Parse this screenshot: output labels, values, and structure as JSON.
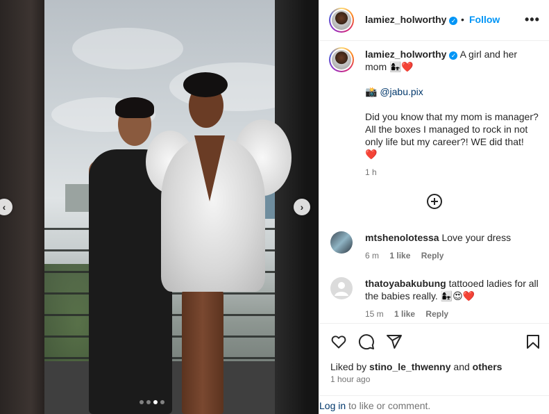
{
  "post": {
    "username": "lamiez_holworthy",
    "follow_label": "Follow",
    "more_label": "•••",
    "separator": "•"
  },
  "caption": {
    "username": "lamiez_holworthy",
    "line1": "A girl and her mom 👩‍👧❤️",
    "credit_icon": "📸",
    "credit_handle": "@jabu.pix",
    "body": "Did you know that my mom is manager? All the boxes I managed to rock in not only life but my career?! WE did that! ❤️",
    "time": "1 h"
  },
  "comments": [
    {
      "username": "mtshenolotessa",
      "text": "Love your dress",
      "time": "6 m",
      "likes": "1 like",
      "reply": "Reply"
    },
    {
      "username": "thatoyabakubung",
      "text": "tattooed ladies for all the babies really. 👩‍👧😍❤️",
      "time": "15 m",
      "likes": "1 like",
      "reply": "Reply"
    }
  ],
  "likes": {
    "prefix": "Liked by",
    "user": "stino_le_thwenny",
    "and": "and",
    "others": "others",
    "ago": "1 hour ago"
  },
  "login": {
    "link": "Log in",
    "rest": "to like or comment."
  },
  "carousel": {
    "prev_icon": "‹",
    "next_icon": "›",
    "total_slides": 4,
    "active_slide": 3
  },
  "icons": {
    "heart": "heart-icon",
    "comment": "comment-icon",
    "share": "share-icon",
    "save": "bookmark-icon",
    "add": "plus-circle-icon",
    "verified": "verified-badge-icon"
  },
  "colors": {
    "link_blue": "#0095f6",
    "text": "#262626",
    "muted": "#737373"
  }
}
